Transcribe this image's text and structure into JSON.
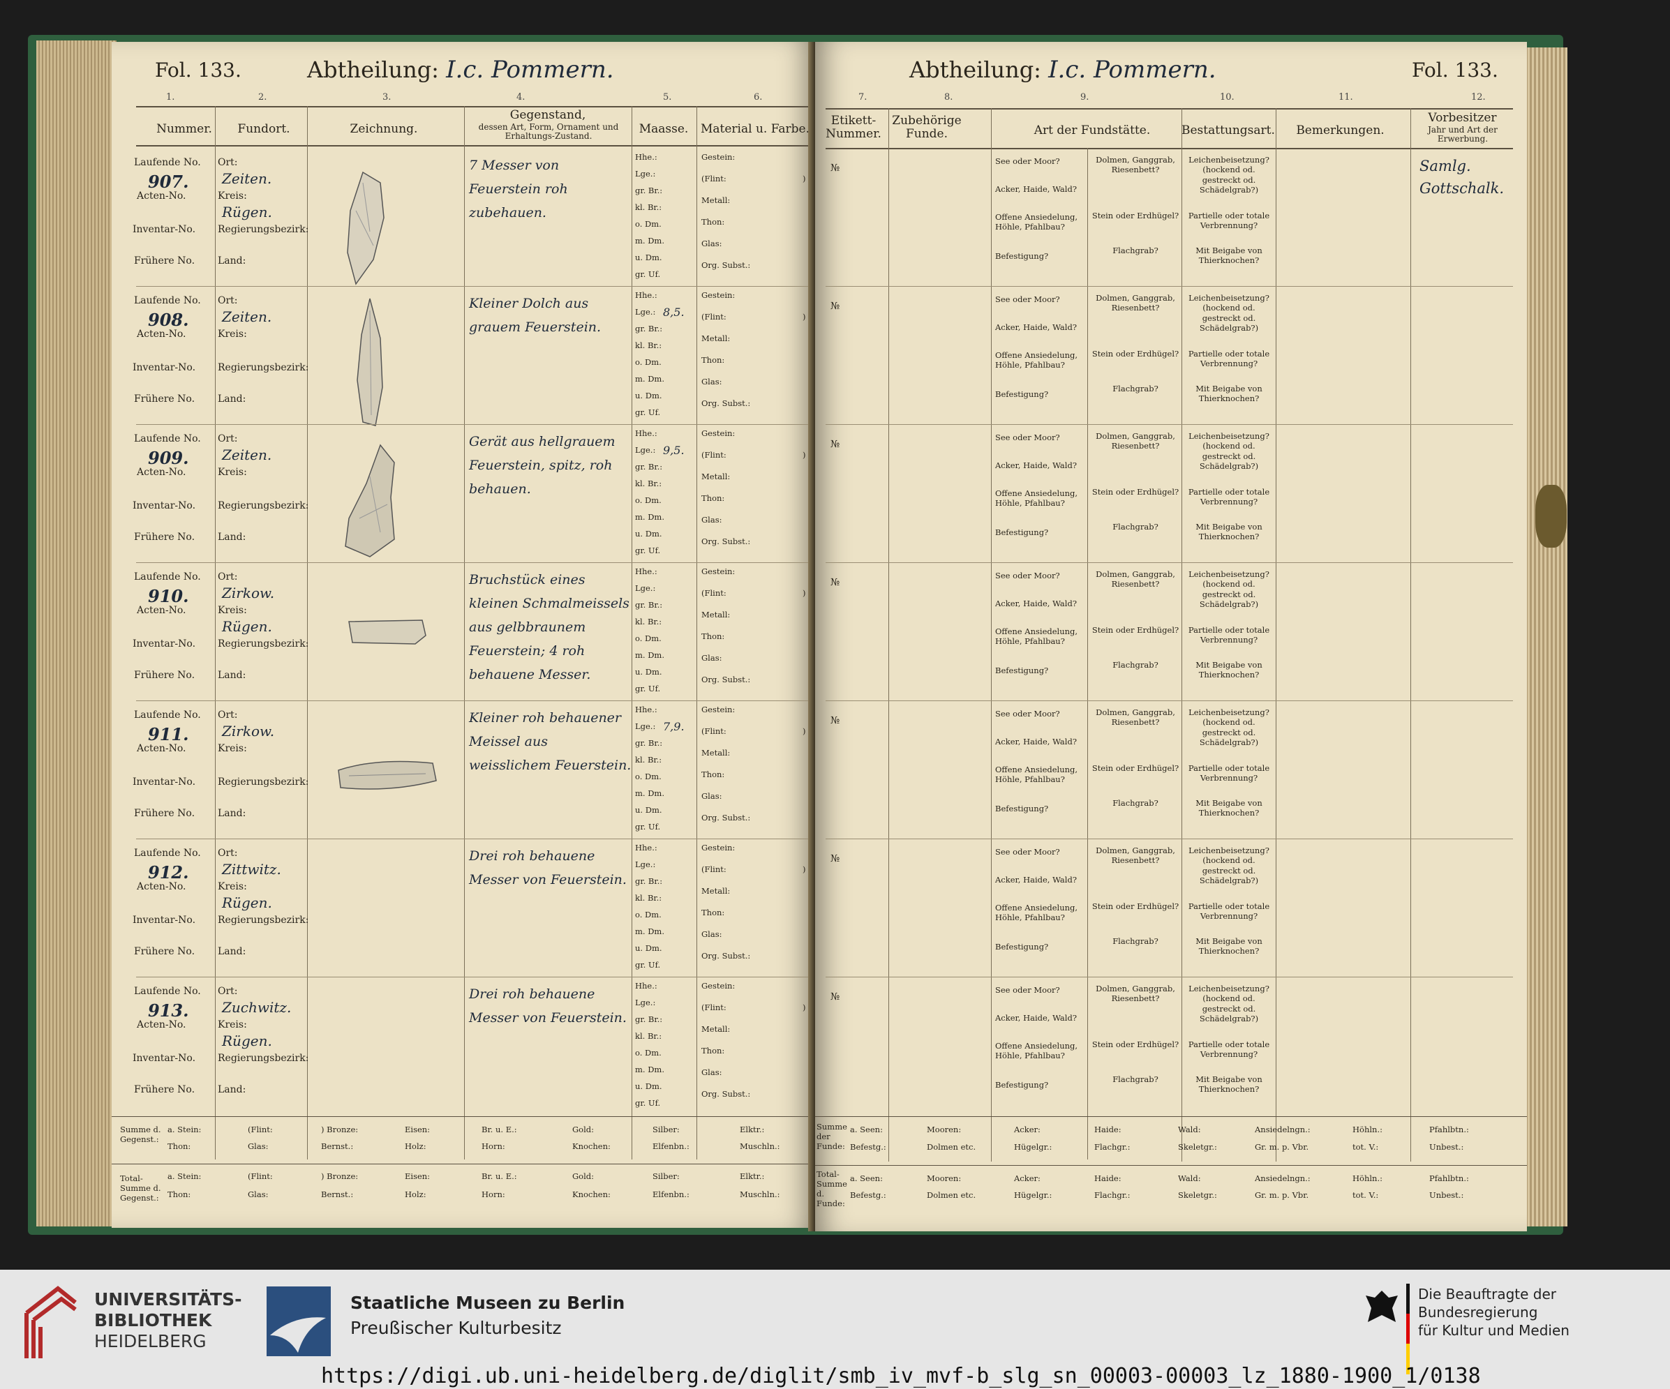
{
  "left_page": {
    "folio": "Fol. 133.",
    "abtheilung_label": "Abtheilung:",
    "abtheilung_value": "I.c. Pommern.",
    "col_numbers": [
      "1.",
      "2.",
      "3.",
      "4.",
      "5.",
      "6."
    ],
    "headers": {
      "nummer": "Nummer.",
      "fundort": "Fundort.",
      "zeichnung": "Zeichnung.",
      "gegenstand_title": "Gegenstand,",
      "gegenstand_sub": "dessen Art, Form, Ornament und Erhaltungs-Zustand.",
      "maasse": "Maasse.",
      "material": "Material u. Farbe."
    },
    "labels": {
      "laufende": "Laufende No.",
      "acten": "Acten-No.",
      "inventar": "Inventar-No.",
      "fruehere": "Frühere No.",
      "ort": "Ort:",
      "kreis": "Kreis:",
      "regbez": "Regierungsbezirk:",
      "land": "Land:",
      "measures": [
        "Hhe.:",
        "Lge.:",
        "gr. Br.:",
        "kl. Br.:",
        "o. Dm.",
        "m. Dm.",
        "u. Dm.",
        "gr. Uf."
      ],
      "materials": [
        "Gestein:",
        "(Flint:",
        "Metall:",
        "Thon:",
        "Glas:",
        "Org. Subst.:"
      ],
      "paren_close": ")"
    },
    "entries": [
      {
        "num": "907.",
        "ort": "Zeiten.",
        "kreis": "Rügen.",
        "desc": "7 Messer von Feuerstein roh zubehauen.",
        "lge": ""
      },
      {
        "num": "908.",
        "ort": "Zeiten.",
        "kreis": "",
        "desc": "Kleiner Dolch aus grauem Feuerstein.",
        "lge": "8,5."
      },
      {
        "num": "909.",
        "ort": "Zeiten.",
        "kreis": "",
        "desc": "Gerät aus hellgrauem Feuerstein, spitz, roh behauen.",
        "lge": "9,5."
      },
      {
        "num": "910.",
        "ort": "Zirkow.",
        "kreis": "Rügen.",
        "desc": "Bruchstück eines kleinen Schmalmeissels aus gelbbraunem Feuerstein; 4 roh behauene Messer.",
        "lge": ""
      },
      {
        "num": "911.",
        "ort": "Zirkow.",
        "kreis": "",
        "desc": "Kleiner roh behauener Meissel aus weisslichem Feuerstein.",
        "lge": "7,9."
      },
      {
        "num": "912.",
        "ort": "Zittwitz.",
        "kreis": "Rügen.",
        "desc": "Drei roh behauene Messer von Feuerstein.",
        "lge": ""
      },
      {
        "num": "913.",
        "ort": "Zuchwitz.",
        "kreis": "Rügen.",
        "desc": "Drei roh behauene Messer von Feuerstein.",
        "lge": ""
      }
    ],
    "summary": {
      "row1_label": "Summe d. Gegenst.:",
      "row2_label": "Total-Summe d. Gegenst.:",
      "top": [
        "a. Stein:",
        "(Flint:",
        ") Bronze:",
        "Eisen:",
        "Br. u. E.:",
        "Gold:",
        "Silber:",
        "Elktr.:"
      ],
      "bottom": [
        "Thon:",
        "Glas:",
        "Bernst.:",
        "Holz:",
        "Horn:",
        "Knochen:",
        "Elfenbn.:",
        "Muschln.:"
      ]
    }
  },
  "right_page": {
    "folio": "Fol. 133.",
    "abtheilung_label": "Abtheilung:",
    "abtheilung_value": "I.c. Pommern.",
    "col_numbers": [
      "7.",
      "8.",
      "9.",
      "10.",
      "11.",
      "12."
    ],
    "headers": {
      "etikett": "Etikett-Nummer.",
      "zubehoerige": "Zubehörige Funde.",
      "fundstaette": "Art der Fundstätte.",
      "bestattung": "Bestattungsart.",
      "bemerkungen": "Bemerkungen.",
      "vorbesitzer": "Vorbesitzer",
      "vorbesitzer_sub": "Jahr und Art der Erwerbung."
    },
    "labels": {
      "no": "№",
      "fund_a": [
        "See oder Moor?",
        "Acker, Haide, Wald?",
        "Offene Ansiedelung, Höhle, Pfahlbau?",
        "Befestigung?"
      ],
      "fund_b": [
        "Dolmen, Ganggrab, Riesenbett?",
        "Stein oder Erdhügel?",
        "Flachgrab?"
      ],
      "bestattung": [
        "Leichenbeisetzung? (hockend od. gestreckt od. Schädelgrab?)",
        "Partielle oder totale Verbrennung?",
        "Mit Beigabe von Thierknochen?"
      ]
    },
    "vorbesitzer_entry": "Samlg. Gottschalk.",
    "summary": {
      "row1_label": "Summe der Funde:",
      "row2_label": "Total-Summe d. Funde:",
      "top": [
        "a. Seen:",
        "Mooren:",
        "Acker:",
        "Haide:",
        "Wald:",
        "Ansiedelngn.:",
        "Höhln.:",
        "Pfahlbtn.:"
      ],
      "bottom": [
        "Befestg.:",
        "Dolmen etc.",
        "Hügelgr.:",
        "Flachgr.:",
        "Skeletgr.:",
        "Gr. m. p. Vbr.",
        "tot. V.:",
        "Unbest.:"
      ]
    }
  },
  "footer": {
    "ub_line1": "UNIVERSITÄTS-",
    "ub_line2": "BIBLIOTHEK",
    "ub_line3": "HEIDELBERG",
    "smb_line1": "Staatliche Museen zu Berlin",
    "smb_line2": "Preußischer Kulturbesitz",
    "bkm_line1": "Die Beauftragte der Bundesregierung",
    "bkm_line2": "für Kultur und Medien",
    "url": "https://digi.ub.uni-heidelberg.de/diglit/smb_iv_mvf-b_slg_sn_00003-00003_lz_1880-1900_1/0138"
  },
  "colors": {
    "paper": "#ece2c6",
    "cover": "#2f5f3e",
    "ink": "#1f2a3a",
    "ub_red": "#b22a2a",
    "smb_blue": "#2b4f7e"
  }
}
